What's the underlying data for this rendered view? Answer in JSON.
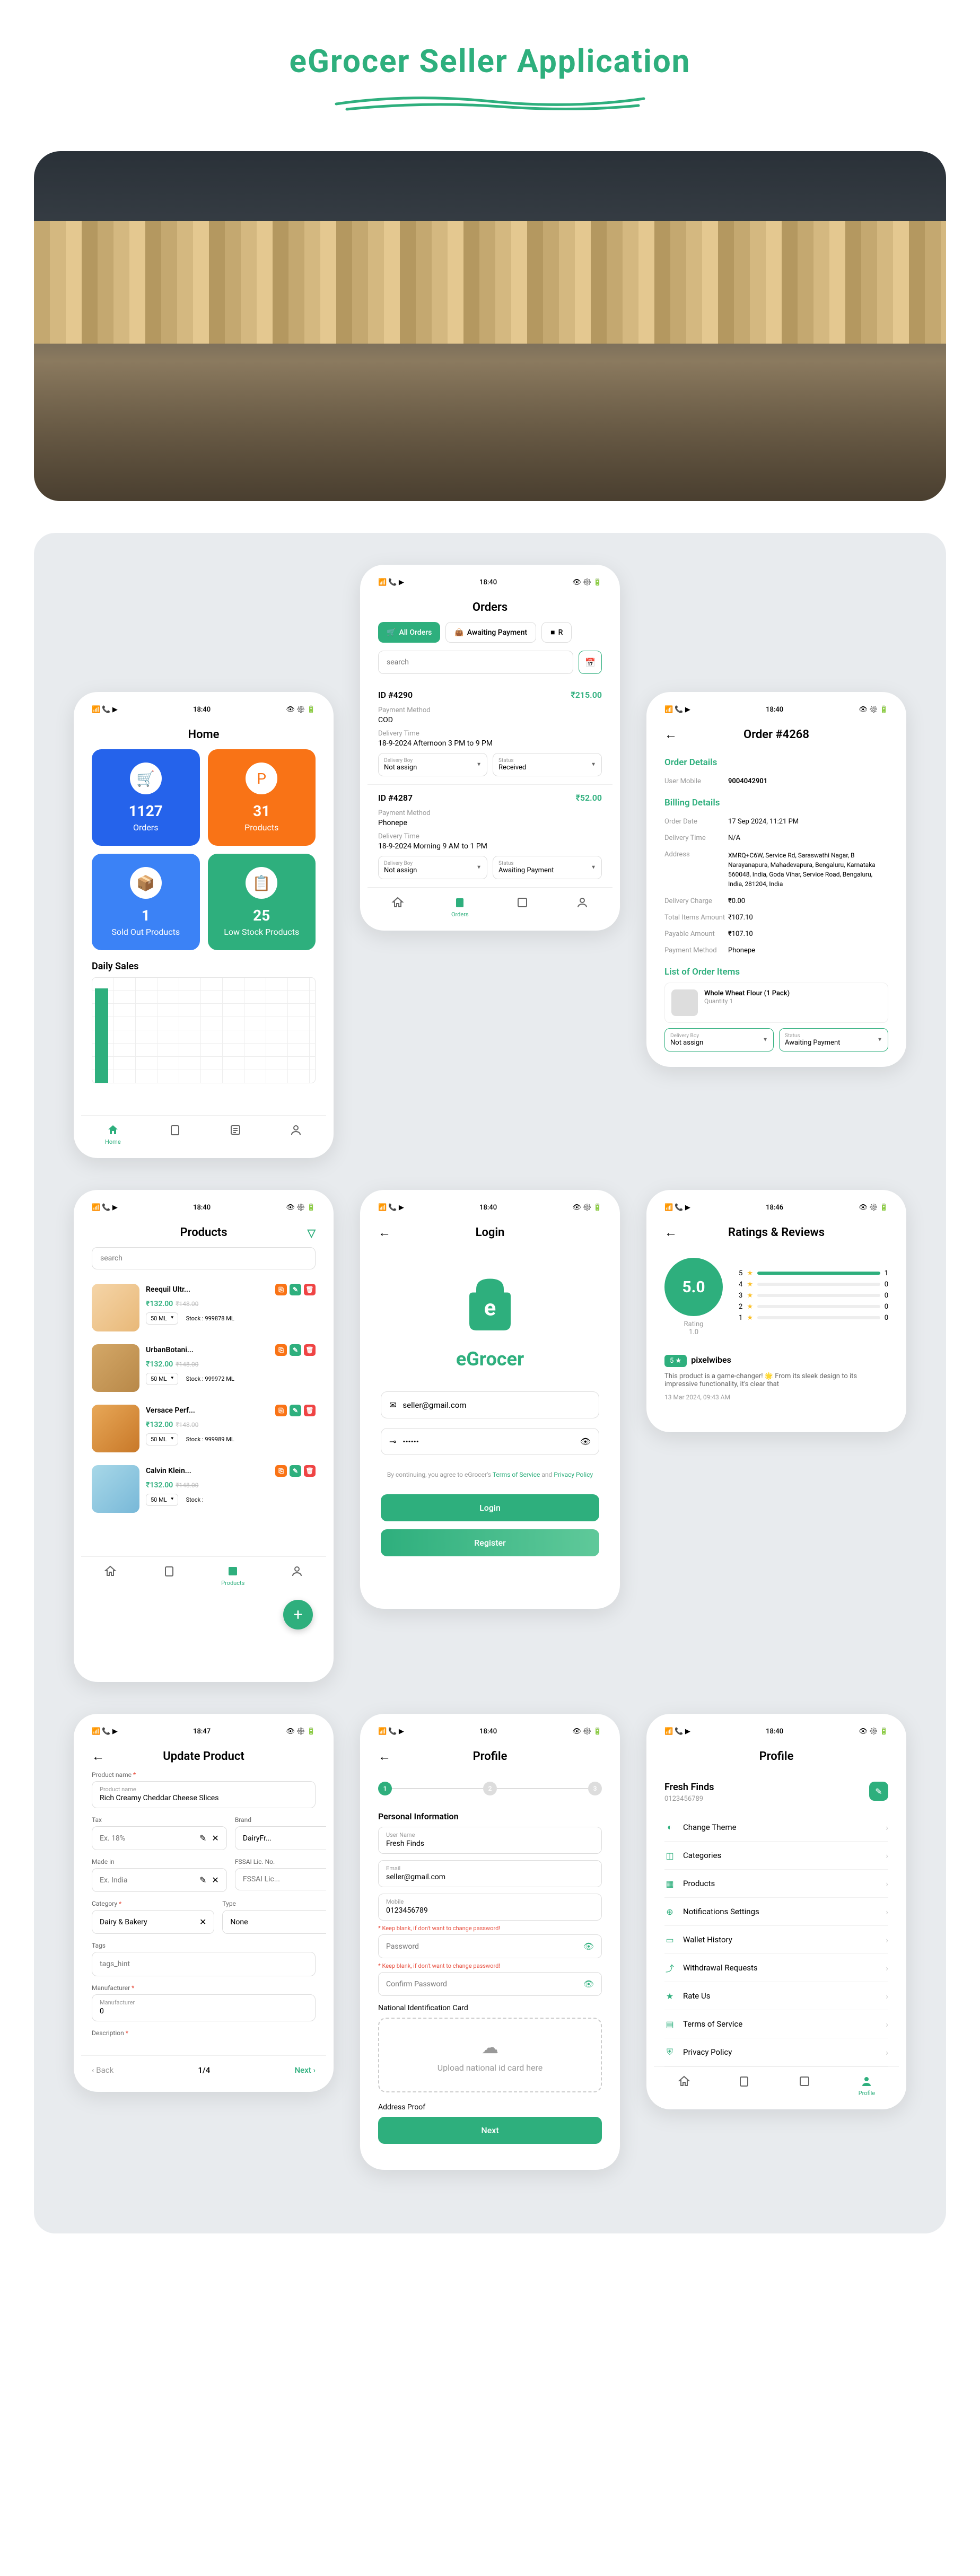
{
  "title": "eGrocer Seller Application",
  "statusBar": {
    "time": "18:40"
  },
  "home": {
    "title": "Home",
    "cards": [
      {
        "num": "1127",
        "label": "Orders"
      },
      {
        "num": "31",
        "label": "Products"
      },
      {
        "num": "1",
        "label": "Sold Out Products"
      },
      {
        "num": "25",
        "label": "Low Stock Products"
      }
    ],
    "dailySales": "Daily Sales"
  },
  "orders": {
    "title": "Orders",
    "tabs": {
      "all": "All Orders",
      "awaiting": "Awaiting Payment",
      "third": "R"
    },
    "search": "search",
    "list": [
      {
        "id": "ID #4290",
        "price": "₹215.00",
        "pmLabel": "Payment Method",
        "pm": "COD",
        "dtLabel": "Delivery Time",
        "dt": "18-9-2024 Afternoon 3 PM to 9 PM",
        "dboyLabel": "Delivery Boy",
        "dboy": "Not assign",
        "statusLabel": "Status",
        "status": "Received"
      },
      {
        "id": "ID #4287",
        "price": "₹52.00",
        "pmLabel": "Payment Method",
        "pm": "Phonepe",
        "dtLabel": "Delivery Time",
        "dt": "18-9-2024 Morning 9 AM to 1 PM",
        "dboyLabel": "Delivery Boy",
        "dboy": "Not assign",
        "statusLabel": "Status",
        "status": "Awaiting Payment"
      }
    ]
  },
  "orderDetail": {
    "title": "Order #4268",
    "sections": {
      "details": "Order Details",
      "billing": "Billing Details",
      "items": "List of Order Items"
    },
    "rows": {
      "userMobileL": "User Mobile",
      "userMobile": "9004042901",
      "orderDateL": "Order Date",
      "orderDate": "17 Sep 2024, 11:21 PM",
      "deliveryTimeL": "Delivery Time",
      "deliveryTime": "N/A",
      "addressL": "Address",
      "address": "XMRQ+C6W, Service Rd, Saraswathi Nagar, B Narayanapura, Mahadevapura, Bengaluru, Karnataka 560048, India, Goda Vihar, Service Road, Bengaluru, India, 281204, India",
      "deliveryChargeL": "Delivery Charge",
      "deliveryCharge": "₹0.00",
      "totalItemsL": "Total Items Amount",
      "totalItems": "₹107.10",
      "payableL": "Payable Amount",
      "payable": "₹107.10",
      "payMethodL": "Payment Method",
      "payMethod": "Phonepe"
    },
    "item": {
      "name": "Whole Wheat Flour (1 Pack)",
      "qtyL": "Quantity",
      "qty": "1",
      "dboyL": "Delivery Boy",
      "dboy": "Not assign",
      "statusL": "Status",
      "status": "Awaiting Payment"
    }
  },
  "login": {
    "title": "Login",
    "brand": "eGrocer",
    "email": "seller@gmail.com",
    "password": "••••••",
    "terms1": "By continuing, you agree to eGrocer's ",
    "terms2": "Terms of Service",
    "terms3": " and ",
    "terms4": "Privacy Policy",
    "loginBtn": "Login",
    "registerBtn": "Register"
  },
  "products": {
    "title": "Products",
    "search": "search",
    "list": [
      {
        "name": "Reequil Ultr...",
        "price": "₹132.00",
        "old": "₹148.00",
        "size": "50 ML",
        "stockL": "Stock :",
        "stock": "999878 ML"
      },
      {
        "name": "UrbanBotani...",
        "price": "₹132.00",
        "old": "₹148.00",
        "size": "50 ML",
        "stockL": "Stock :",
        "stock": "999972 ML"
      },
      {
        "name": "Versace Perf...",
        "price": "₹132.00",
        "old": "₹148.00",
        "size": "50 ML",
        "stockL": "Stock :",
        "stock": "999989 ML"
      },
      {
        "name": "Calvin Klein...",
        "price": "₹132.00",
        "old": "₹148.00",
        "size": "50 ML",
        "stockL": "Stock :",
        "stock": ""
      }
    ]
  },
  "ratings": {
    "title": "Ratings & Reviews",
    "time": "18:46",
    "score": "5.0",
    "ratingL": "Rating",
    "count": "1.0",
    "bars": [
      {
        "n": "5",
        "v": "1"
      },
      {
        "n": "4",
        "v": "0"
      },
      {
        "n": "3",
        "v": "0"
      },
      {
        "n": "2",
        "v": "0"
      },
      {
        "n": "1",
        "v": "0"
      }
    ],
    "review": {
      "stars": "5 ★",
      "user": "pixelwibes",
      "text": "This product is a game-changer! 🌟 From its sleek design to its impressive functionality, it's clear that",
      "date": "13 Mar 2024, 09:43 AM"
    }
  },
  "updateProduct": {
    "title": "Update Product",
    "time": "18:47",
    "pnameL": "Product name",
    "pnameHint": "Product name",
    "pname": "Rich Creamy Cheddar Cheese Slices",
    "taxL": "Tax",
    "tax": "Ex. 18%",
    "brandL": "Brand",
    "brand": "DairyFr...",
    "madeL": "Made in",
    "made": "Ex. India",
    "fssaiL": "FSSAI Lic. No.",
    "fssai": "FSSAI Lic...",
    "catL": "Category",
    "cat": "Dairy & Bakery",
    "typeL": "Type",
    "type": "None",
    "tagsL": "Tags",
    "tags": "tags_hint",
    "mfgL": "Manufacturer",
    "mfgHint": "Manufacturer",
    "mfg": "0",
    "descL": "Description",
    "back": "Back",
    "page": "1/4",
    "next": "Next"
  },
  "profileEdit": {
    "title": "Profile",
    "section": "Personal Information",
    "unameL": "User Name",
    "uname": "Fresh Finds",
    "emailL": "Email",
    "email": "seller@gmail.com",
    "mobileL": "Mobile",
    "mobile": "0123456789",
    "pwHint": "* Keep blank, if don't want to change password!",
    "pwPlace": "Password",
    "cpwPlace": "Confirm Password",
    "nidL": "National Identification Card",
    "uploadText": "Upload national id card here",
    "addressL": "Address Proof",
    "next": "Next"
  },
  "profile": {
    "title": "Profile",
    "name": "Fresh Finds",
    "id": "0123456789",
    "items": [
      "Change Theme",
      "Categories",
      "Products",
      "Notifications Settings",
      "Wallet History",
      "Withdrawal Requests",
      "Rate Us",
      "Terms of Service",
      "Privacy Policy"
    ]
  },
  "nav": {
    "home": "Home",
    "orders": "Orders",
    "products": "Products",
    "profile": "Profile"
  }
}
